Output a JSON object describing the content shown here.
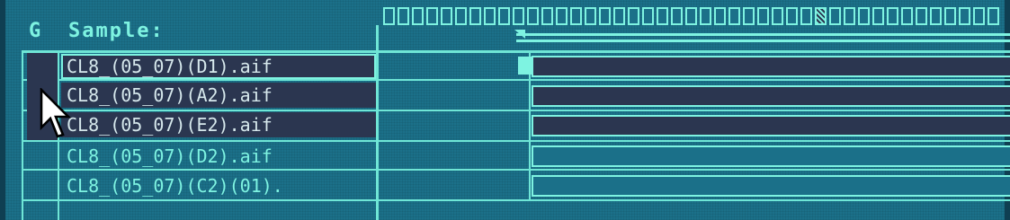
{
  "header": {
    "group_label": "G",
    "title": "Sample:"
  },
  "samples": [
    {
      "name": "CL8_(05_07)(D1).aif",
      "selected": true,
      "active": true
    },
    {
      "name": "CL8_(05_07)(A2).aif",
      "selected": true,
      "active": false
    },
    {
      "name": "CL8_(05_07)(E2).aif",
      "selected": true,
      "active": false
    },
    {
      "name": "CL8_(05_07)(D2).aif",
      "selected": false,
      "active": false
    },
    {
      "name": "CL8_(05_07)(C2)(01).",
      "selected": false,
      "active": false
    }
  ],
  "colors": {
    "background": "#1b7089",
    "accent": "#7ef3e1",
    "selected": "#2b3650"
  },
  "icons": {
    "cursor": "mouse-pointer-icon",
    "loop_start": "sample-start-handle-icon"
  }
}
